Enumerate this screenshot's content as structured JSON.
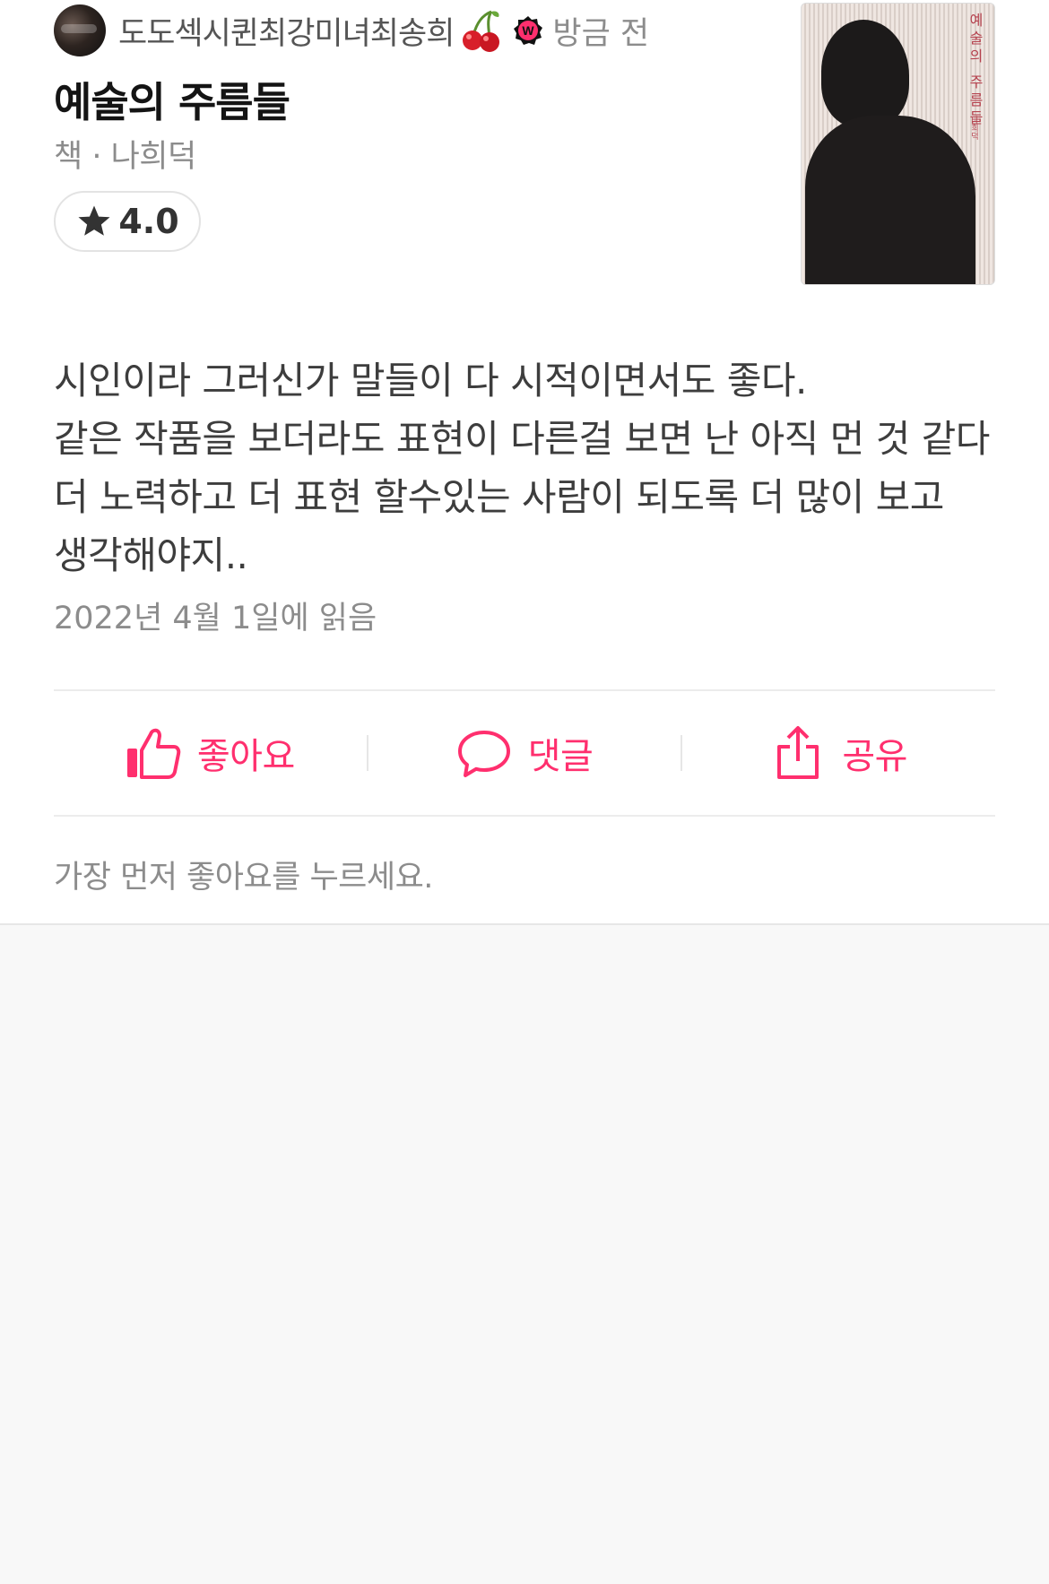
{
  "user": {
    "name": "도도섹시퀸최강미녀최송희",
    "time": "방금 전",
    "badge_icon": "watcha-badge-icon",
    "emoji_icon": "cherry-icon"
  },
  "book": {
    "title": "예술의 주름들",
    "meta": "책 · 나희덕",
    "rating": "4.0",
    "cover_title": "예술의 주름들",
    "cover_author": "나희덕"
  },
  "review": {
    "text": "시인이라 그러신가 말들이 다 시적이면서도 좋다.\n같은 작품을 보더라도 표현이 다른걸 보면 난 아직 먼 것 같다 더 노력하고 더 표현 할수있는 사람이 되도록 더 많이 보고 생각해야지..",
    "read_date": "2022년 4월 1일에 읽음"
  },
  "actions": {
    "like": "좋아요",
    "comment": "댓글",
    "share": "공유"
  },
  "likes_hint": "가장 먼저 좋아요를 누르세요.",
  "colors": {
    "accent": "#ff2f6e",
    "muted_text": "#8c8c8c",
    "background": "#f8f8f8"
  }
}
